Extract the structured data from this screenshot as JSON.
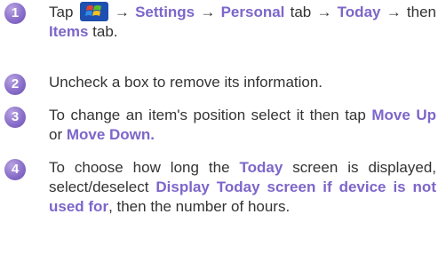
{
  "steps": [
    {
      "number": "1",
      "t1": "Tap",
      "icon": "windows-start-icon",
      "t2": " → ",
      "b1": "Settings",
      "t3": " → ",
      "b2": "Personal",
      "t4": " tab → ",
      "b3": "Today",
      "t5": " → then ",
      "b4": "Items",
      "t6": " tab."
    },
    {
      "number": "2",
      "t1": "Uncheck a box to remove its information."
    },
    {
      "number": "3",
      "t1": "To change an item's position select it then tap ",
      "b1": "Move Up",
      "t2": " or ",
      "b2": "Move Down."
    },
    {
      "number": "4",
      "t1": "To choose how long the ",
      "b1": "Today",
      "t2": " screen is displayed, select/deselect ",
      "b2": "Display Today screen if device is not used for",
      "t3": ", then the number of hours."
    }
  ],
  "colors": {
    "accent": "#7d66c9",
    "badge": "#8a6fcb",
    "text": "#333333"
  }
}
